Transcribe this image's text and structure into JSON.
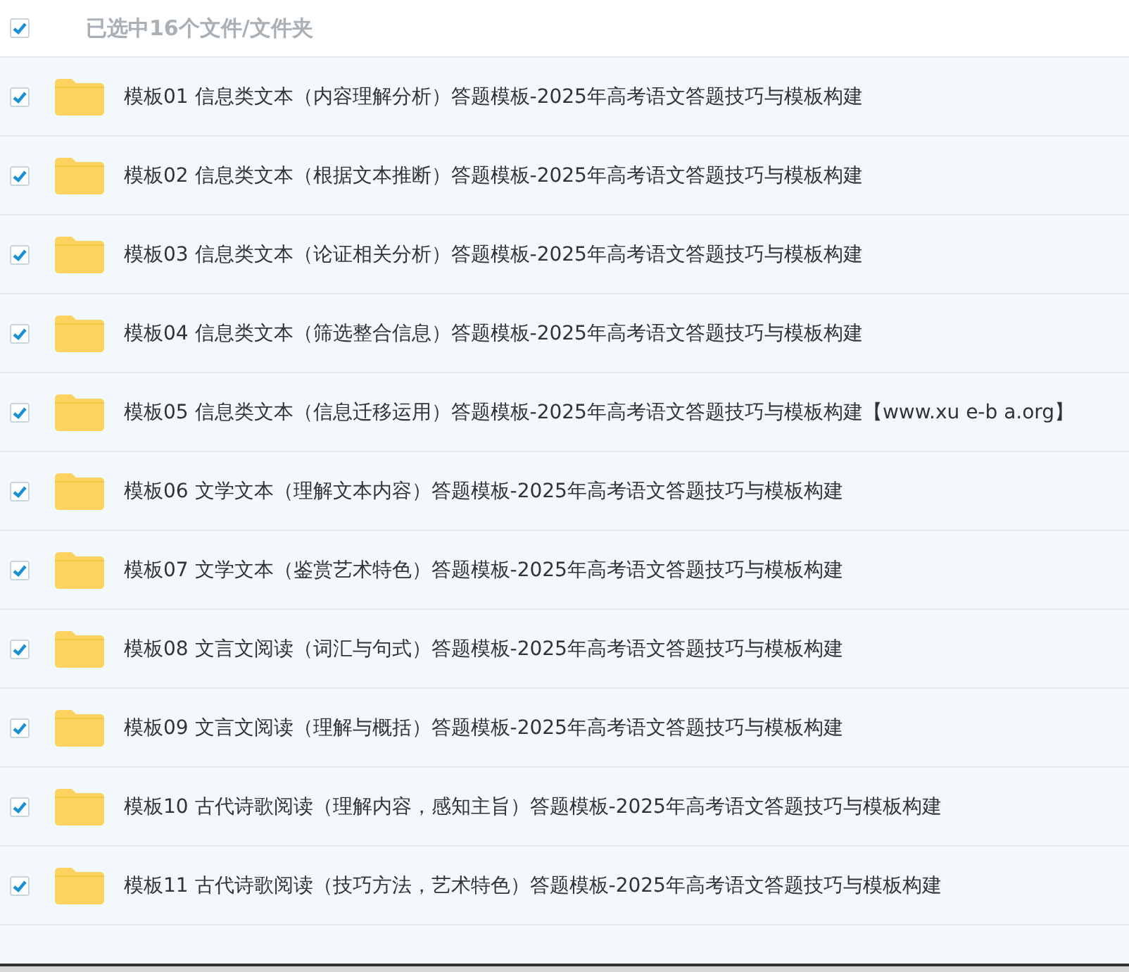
{
  "header": {
    "checked": true,
    "label": "已选中16个文件/文件夹"
  },
  "files": [
    {
      "name": "模板01 信息类文本（内容理解分析）答题模板-2025年高考语文答题技巧与模板构建",
      "checked": true
    },
    {
      "name": "模板02 信息类文本（根据文本推断）答题模板-2025年高考语文答题技巧与模板构建",
      "checked": true
    },
    {
      "name": "模板03 信息类文本（论证相关分析）答题模板-2025年高考语文答题技巧与模板构建",
      "checked": true
    },
    {
      "name": "模板04 信息类文本（筛选整合信息）答题模板-2025年高考语文答题技巧与模板构建",
      "checked": true
    },
    {
      "name": "模板05 信息类文本（信息迁移运用）答题模板-2025年高考语文答题技巧与模板构建【www.xu e-b a.org】",
      "checked": true
    },
    {
      "name": "模板06 文学文本（理解文本内容）答题模板-2025年高考语文答题技巧与模板构建",
      "checked": true
    },
    {
      "name": "模板07 文学文本（鉴赏艺术特色）答题模板-2025年高考语文答题技巧与模板构建",
      "checked": true
    },
    {
      "name": "模板08 文言文阅读（词汇与句式）答题模板-2025年高考语文答题技巧与模板构建",
      "checked": true
    },
    {
      "name": "模板09 文言文阅读（理解与概括）答题模板-2025年高考语文答题技巧与模板构建",
      "checked": true
    },
    {
      "name": "模板10 古代诗歌阅读（理解内容，感知主旨）答题模板-2025年高考语文答题技巧与模板构建",
      "checked": true
    },
    {
      "name": "模板11 古代诗歌阅读（技巧方法，艺术特色）答题模板-2025年高考语文答题技巧与模板构建",
      "checked": true
    }
  ]
}
